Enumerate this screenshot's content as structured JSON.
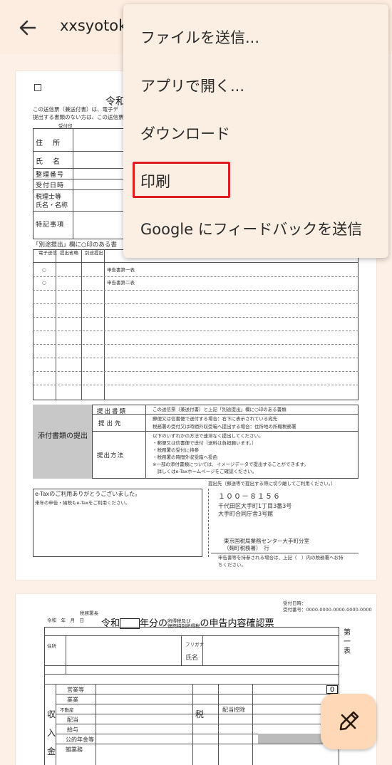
{
  "header": {
    "title": "xxsyotoku",
    "back_icon": "arrow-left-icon"
  },
  "menu": {
    "items": [
      {
        "label": "ファイルを送信..."
      },
      {
        "label": "アプリで開く..."
      },
      {
        "label": "ダウンロード"
      },
      {
        "label": "印刷"
      },
      {
        "label": "Google にフィードバックを送信"
      }
    ],
    "highlight_color": "#e01c22"
  },
  "page1": {
    "reiwa": "令和",
    "notice_line1": "この送信票（兼送付書）は、電子デ",
    "notice_line2": "提出する書類のない方は、この送信票",
    "stamp_label": "受付印",
    "rows": [
      "住　所",
      "氏　名",
      "整理番号",
      "受付日時",
      "税理士等",
      "氏名・名称",
      "特記事項"
    ],
    "separate_note": "「別途提出」欄に○印のある書",
    "col_headers": [
      "電子送信",
      "提出省略",
      "別途提出"
    ],
    "list_items": [
      {
        "mark": "○",
        "text": "申告書第一表"
      },
      {
        "mark": "○",
        "text": "申告書第二表"
      }
    ],
    "attach_title": "添付書類の提出",
    "attach_rows": [
      {
        "label": "提出書類",
        "text": "この送信票（兼送付書）と上記「別途提出」欄に○印のある書類"
      },
      {
        "label": "提出先",
        "text1": "郵便又は信書便で送付する場合：右下に表示されている宛先",
        "text2": "税務署の受付又は時間外収受箱へ提出する場合：住所地の所轄税務署"
      },
      {
        "label": "提出方法",
        "lines": [
          "以下のいずれかの方法で速滞なく提出してください。",
          "・郵便又は信書便で送付（送料は負担願います。）",
          "・税務署の受付に持参",
          "・税務署の時間外収受箱へ投函",
          "※一部の添付書類については、イメージデータで提出することができます。",
          "　詳しくはe-Taxホームページをご確認ください。"
        ]
      }
    ],
    "etax_msg1": "e-Taxのご利用ありがとうございました。",
    "etax_msg2": "来年の申告・納税もe-Taxをご利用ください。",
    "cut_note": "提出先（郵送等で提出する際に切り離してご利用ください。）",
    "postal": "１００－８１５６",
    "address1": "千代田区大手町1丁目3番3号",
    "address2": "大手町合同庁舎3号館",
    "center1": "東京国税局業務センター大手町分室",
    "center2": "（麹町税務署）　行",
    "foot1": "申告書等を持参される場合は、上記（　）内の税務署へお持",
    "foot2": "ちください。"
  },
  "page2": {
    "receipt_date": "受付日時：",
    "receipt_no": "受付番号：0000-0000-0000-0000-0000",
    "tax_office": "税務署長",
    "year_line": "令和　年　月　日",
    "title_pre": "令和",
    "title_mid": "年分の",
    "title_small1": "所得税及び",
    "title_small2": "復興特別所得税",
    "title_post": "の申告内容確認票",
    "side_label": "第一表",
    "number": "0",
    "labels": [
      "住所",
      "フリガナ",
      "氏名",
      "営業等",
      "業業",
      "不動産",
      "配当",
      "給与",
      "公的年金等",
      "雑業務",
      "税",
      "配当控除",
      "収",
      "入",
      "金"
    ]
  },
  "fab_icon": "edit-pen-icon"
}
